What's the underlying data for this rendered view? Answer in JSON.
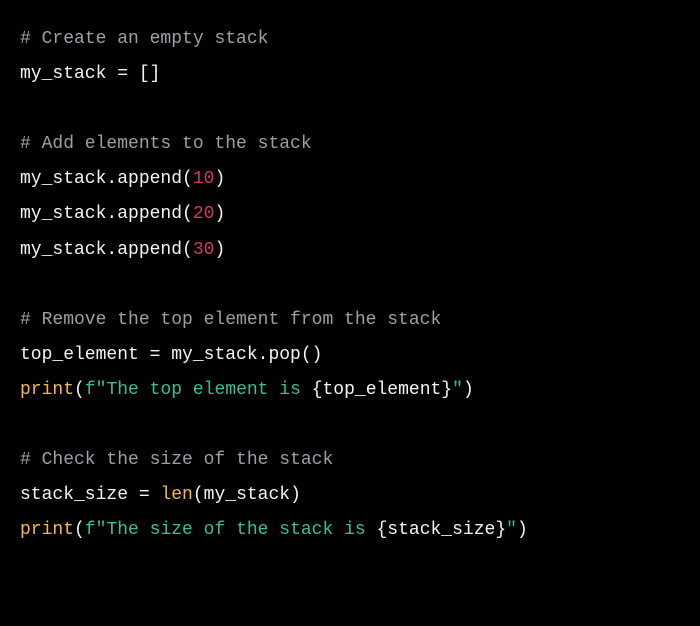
{
  "code": {
    "lines": [
      {
        "type": "comment",
        "text": "# Create an empty stack"
      },
      {
        "type": "plain",
        "segments": [
          {
            "cls": "tok-default",
            "t": "my_stack "
          },
          {
            "cls": "tok-operator",
            "t": "="
          },
          {
            "cls": "tok-default",
            "t": " []"
          }
        ]
      },
      {
        "type": "blank",
        "text": ""
      },
      {
        "type": "comment",
        "text": "# Add elements to the stack"
      },
      {
        "type": "plain",
        "segments": [
          {
            "cls": "tok-default",
            "t": "my_stack.append("
          },
          {
            "cls": "tok-number",
            "t": "10"
          },
          {
            "cls": "tok-default",
            "t": ")"
          }
        ]
      },
      {
        "type": "plain",
        "segments": [
          {
            "cls": "tok-default",
            "t": "my_stack.append("
          },
          {
            "cls": "tok-number",
            "t": "20"
          },
          {
            "cls": "tok-default",
            "t": ")"
          }
        ]
      },
      {
        "type": "plain",
        "segments": [
          {
            "cls": "tok-default",
            "t": "my_stack.append("
          },
          {
            "cls": "tok-number",
            "t": "30"
          },
          {
            "cls": "tok-default",
            "t": ")"
          }
        ]
      },
      {
        "type": "blank",
        "text": ""
      },
      {
        "type": "comment",
        "text": "# Remove the top element from the stack"
      },
      {
        "type": "plain",
        "segments": [
          {
            "cls": "tok-default",
            "t": "top_element "
          },
          {
            "cls": "tok-operator",
            "t": "="
          },
          {
            "cls": "tok-default",
            "t": " my_stack.pop()"
          }
        ]
      },
      {
        "type": "plain",
        "segments": [
          {
            "cls": "tok-builtin",
            "t": "print"
          },
          {
            "cls": "tok-punct",
            "t": "("
          },
          {
            "cls": "tok-fstring-prefix",
            "t": "f"
          },
          {
            "cls": "tok-string",
            "t": "\"The top element is "
          },
          {
            "cls": "tok-interp",
            "t": "{top_element}"
          },
          {
            "cls": "tok-string",
            "t": "\""
          },
          {
            "cls": "tok-punct",
            "t": ")"
          }
        ]
      },
      {
        "type": "blank",
        "text": ""
      },
      {
        "type": "comment",
        "text": "# Check the size of the stack"
      },
      {
        "type": "plain",
        "segments": [
          {
            "cls": "tok-default",
            "t": "stack_size "
          },
          {
            "cls": "tok-operator",
            "t": "="
          },
          {
            "cls": "tok-default",
            "t": " "
          },
          {
            "cls": "tok-builtin",
            "t": "len"
          },
          {
            "cls": "tok-default",
            "t": "(my_stack)"
          }
        ]
      },
      {
        "type": "plain",
        "segments": [
          {
            "cls": "tok-builtin",
            "t": "print"
          },
          {
            "cls": "tok-punct",
            "t": "("
          },
          {
            "cls": "tok-fstring-prefix",
            "t": "f"
          },
          {
            "cls": "tok-string",
            "t": "\"The size of the stack is "
          },
          {
            "cls": "tok-interp",
            "t": "{stack_size}"
          },
          {
            "cls": "tok-string",
            "t": "\""
          },
          {
            "cls": "tok-punct",
            "t": ")"
          }
        ]
      }
    ]
  }
}
